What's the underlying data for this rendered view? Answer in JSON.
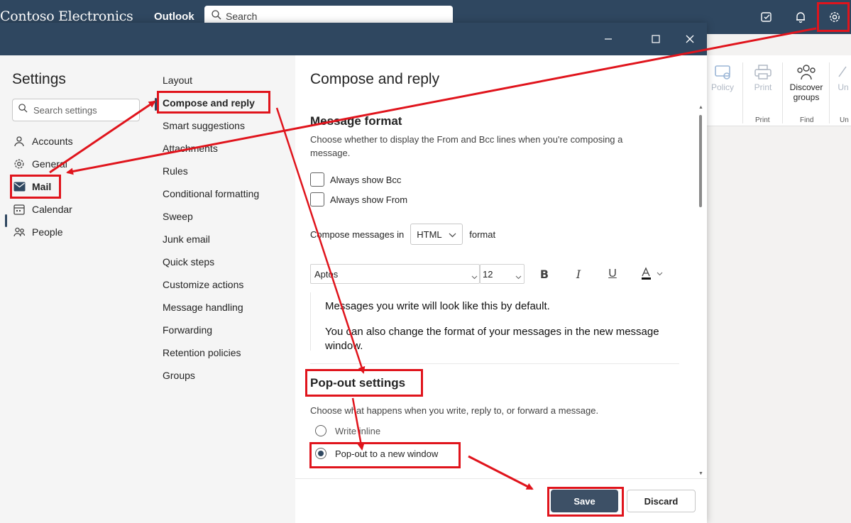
{
  "topbar": {
    "brand": "Contoso Electronics",
    "app": "Outlook",
    "search_label": "Search"
  },
  "ribbon": {
    "items": [
      {
        "label": "Policy",
        "icon": "policy-icon"
      },
      {
        "label": "Print",
        "icon": "printer-icon"
      },
      {
        "label": "Discover groups",
        "icon": "people-group-icon"
      },
      {
        "label": "Un",
        "icon": "undo-icon"
      }
    ],
    "groups": [
      "Print",
      "Find",
      "Un"
    ]
  },
  "settings": {
    "title": "Settings",
    "search_placeholder": "Search settings",
    "categories": [
      {
        "label": "Accounts",
        "icon": "person-icon"
      },
      {
        "label": "General",
        "icon": "gear-icon"
      },
      {
        "label": "Mail",
        "icon": "mail-icon"
      },
      {
        "label": "Calendar",
        "icon": "calendar-icon"
      },
      {
        "label": "People",
        "icon": "people-icon"
      }
    ],
    "selected_category": "Mail"
  },
  "mail_nav": {
    "items": [
      "Layout",
      "Compose and reply",
      "Smart suggestions",
      "Attachments",
      "Rules",
      "Conditional formatting",
      "Sweep",
      "Junk email",
      "Quick steps",
      "Customize actions",
      "Message handling",
      "Forwarding",
      "Retention policies",
      "Groups"
    ],
    "selected": "Compose and reply"
  },
  "content": {
    "title": "Compose and reply",
    "message_format": {
      "heading": "Message format",
      "description": "Choose whether to display the From and Bcc lines when you're composing a message.",
      "always_show_bcc": "Always show Bcc",
      "always_show_from": "Always show From",
      "compose_prefix": "Compose messages in",
      "format_value": "HTML",
      "compose_suffix": "format",
      "font_value": "Aptos",
      "size_value": "12",
      "preview_line1": "Messages you write will look like this by default.",
      "preview_line2": "You can also change the format of your messages in the new message window."
    },
    "popout": {
      "heading": "Pop-out settings",
      "description": "Choose what happens when you write, reply to, or forward a message.",
      "option_inline": "Write inline",
      "option_new_window": "Pop-out to a new window",
      "selected": "Pop-out to a new window"
    },
    "footer": {
      "save": "Save",
      "discard": "Discard"
    }
  },
  "colors": {
    "titlebar": "#2f4760",
    "annotation": "#e0141c",
    "primary_button": "#3d5066"
  }
}
